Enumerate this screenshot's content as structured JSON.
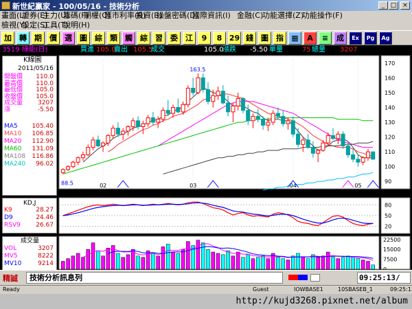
{
  "window": {
    "title": "新世紀贏家 - 100/05/16 - 技術分析"
  },
  "menu1": [
    {
      "label": "畫面(L)"
    },
    {
      "label": "證券(E)"
    },
    {
      "label": "主力(U)"
    },
    {
      "label": "籌碼(F)"
    },
    {
      "label": "期權(O)"
    },
    {
      "label": "匯市利率(R)"
    },
    {
      "label": "投資(B)"
    },
    {
      "label": "操盤密碼(D)"
    },
    {
      "label": "國際資訊(I)"
    },
    {
      "label": "金融(C)"
    },
    {
      "label": "功能選擇(Z)"
    },
    {
      "label": "功能操作(F)"
    }
  ],
  "menu2": [
    {
      "label": "檢視(Y)"
    },
    {
      "label": "設定(S)"
    },
    {
      "label": "工具(T)"
    },
    {
      "label": "說明(H)"
    }
  ],
  "toolbar": [
    {
      "label": "加",
      "icon": "add-icon"
    },
    {
      "label": "轉",
      "icon": "switch-icon"
    },
    {
      "label": "期",
      "icon": "futures-icon"
    },
    {
      "label": "價",
      "icon": "price-icon"
    },
    {
      "label": "選",
      "icon": "select-icon"
    },
    {
      "label": "圖",
      "icon": "chart-icon"
    },
    {
      "label": "綜",
      "icon": "summary-icon"
    },
    {
      "label": "類",
      "icon": "category-icon"
    },
    {
      "label": "觸",
      "icon": "trigger-icon"
    },
    {
      "label": "綜",
      "icon": "summary2-icon"
    },
    {
      "label": "習",
      "icon": "learn-icon"
    },
    {
      "label": "委",
      "icon": "order-icon"
    },
    {
      "label": "江",
      "icon": "river-icon"
    },
    {
      "label": "9",
      "icon": "nine-icon"
    },
    {
      "label": "8",
      "icon": "eight-icon"
    },
    {
      "label": "29",
      "icon": "twentynine-icon"
    },
    {
      "label": "錢",
      "icon": "money-icon"
    },
    {
      "label": "圖",
      "icon": "chart2-icon"
    },
    {
      "label": "指",
      "icon": "index-icon"
    },
    {
      "label": "▦",
      "icon": "grid-icon"
    },
    {
      "label": "A",
      "icon": "a-icon"
    },
    {
      "label": "≡",
      "icon": "list-icon"
    },
    {
      "label": "成",
      "icon": "volume-icon"
    },
    {
      "label": "Ex",
      "icon": "exit-icon"
    },
    {
      "label": "Pg",
      "icon": "page-icon"
    },
    {
      "label": "Ag",
      "icon": "agent-icon"
    }
  ],
  "colors": {
    "up": "#ff0000",
    "down": "#00c0c0",
    "ma5": "#ffffff",
    "ma10": "#ff4040",
    "ma20": "#ff00ff",
    "ma60": "#00ff00",
    "ma120": "#808080",
    "ma240": "#00ffff",
    "k": "#ff0000",
    "d": "#0000ff",
    "vol_up": "#ff00ff",
    "vol_down": "#00ffff"
  },
  "info": {
    "stock": "3519 綠能(日)",
    "bid_label": "買進",
    "bid": "105.0",
    "ask_label": "賣出",
    "ask": "105.5",
    "trade_label": "成交",
    "trade": "105.0",
    "change_label": "漲跌",
    "change": "-5.50",
    "unit_label": "單量",
    "unit": "75",
    "total_label": "總量",
    "total": "3207"
  },
  "kpanel": {
    "title": "K線圖",
    "date": "2011/05/16",
    "rows": [
      {
        "label": "開盤價",
        "value": "110.0"
      },
      {
        "label": "最高價",
        "value": "110.0"
      },
      {
        "label": "最低價",
        "value": "105.0"
      },
      {
        "label": "收盤價",
        "value": "105.0"
      },
      {
        "label": "成交量",
        "value": "3207"
      },
      {
        "label": "漲",
        "value": "-5.50"
      }
    ],
    "ma": [
      {
        "label": "MA5",
        "value": "105.40"
      },
      {
        "label": "MA10",
        "value": "106.85"
      },
      {
        "label": "MA20",
        "value": "112.90"
      },
      {
        "label": "MA60",
        "value": "131.09"
      },
      {
        "label": "MA108",
        "value": "116.86"
      },
      {
        "label": "MA240",
        "value": "96.02"
      }
    ]
  },
  "kdpanel": {
    "title": "KD,J",
    "rows": [
      {
        "label": "K9",
        "value": "28.27"
      },
      {
        "label": "D9",
        "value": "24.46"
      },
      {
        "label": "RSV9",
        "value": "26.67"
      }
    ]
  },
  "volpanel": {
    "title": "成交量",
    "rows": [
      {
        "label": "VOL",
        "value": "3207"
      },
      {
        "label": "MV5",
        "value": "8222"
      },
      {
        "label": "MV10",
        "value": "9214"
      }
    ]
  },
  "chart_data": {
    "type": "candlestick",
    "price_axis": [
      "170",
      "160",
      "150",
      "140",
      "130",
      "120",
      "110",
      "100",
      "90"
    ],
    "x_months": [
      "02",
      "03",
      "04",
      "05"
    ],
    "high_label": "163.5",
    "low_label": "88.5",
    "kd_axis": [
      "80",
      "50",
      "20"
    ],
    "vol_axis": [
      "22500",
      "15000",
      "7500",
      "0"
    ],
    "ylim": [
      85,
      175
    ],
    "candles": [
      [
        96,
        99,
        95,
        98
      ],
      [
        98,
        101,
        97,
        100
      ],
      [
        100,
        104,
        99,
        103
      ],
      [
        103,
        107,
        101,
        106
      ],
      [
        106,
        110,
        104,
        108
      ],
      [
        108,
        115,
        107,
        113
      ],
      [
        113,
        120,
        111,
        118
      ],
      [
        118,
        121,
        113,
        114
      ],
      [
        114,
        117,
        110,
        116
      ],
      [
        116,
        122,
        114,
        121
      ],
      [
        121,
        128,
        119,
        126
      ],
      [
        126,
        130,
        120,
        122
      ],
      [
        122,
        126,
        118,
        124
      ],
      [
        124,
        128,
        121,
        127
      ],
      [
        127,
        133,
        124,
        131
      ],
      [
        131,
        134,
        125,
        127
      ],
      [
        127,
        131,
        122,
        129
      ],
      [
        129,
        135,
        127,
        133
      ],
      [
        133,
        137,
        128,
        130
      ],
      [
        130,
        134,
        126,
        132
      ],
      [
        132,
        140,
        130,
        138
      ],
      [
        138,
        145,
        134,
        136
      ],
      [
        136,
        142,
        133,
        140
      ],
      [
        140,
        146,
        136,
        137
      ],
      [
        137,
        144,
        135,
        142
      ],
      [
        142,
        155,
        140,
        153
      ],
      [
        153,
        160,
        148,
        150
      ],
      [
        150,
        163,
        149,
        160
      ],
      [
        160,
        163,
        150,
        152
      ],
      [
        152,
        157,
        142,
        144
      ],
      [
        144,
        152,
        140,
        148
      ],
      [
        148,
        154,
        145,
        151
      ],
      [
        151,
        155,
        142,
        143
      ],
      [
        143,
        148,
        134,
        137
      ],
      [
        137,
        143,
        130,
        141
      ],
      [
        141,
        150,
        138,
        146
      ],
      [
        146,
        147,
        136,
        138
      ],
      [
        138,
        142,
        128,
        131
      ],
      [
        131,
        136,
        126,
        134
      ],
      [
        134,
        139,
        130,
        132
      ],
      [
        132,
        134,
        125,
        128
      ],
      [
        128,
        133,
        124,
        130
      ],
      [
        130,
        138,
        128,
        136
      ],
      [
        136,
        140,
        132,
        134
      ],
      [
        134,
        138,
        127,
        129
      ],
      [
        129,
        133,
        125,
        131
      ],
      [
        131,
        134,
        120,
        122
      ],
      [
        122,
        126,
        113,
        115
      ],
      [
        115,
        120,
        110,
        118
      ],
      [
        118,
        122,
        112,
        113
      ],
      [
        113,
        117,
        106,
        109
      ],
      [
        109,
        112,
        103,
        111
      ],
      [
        111,
        118,
        110,
        116
      ],
      [
        116,
        123,
        114,
        121
      ],
      [
        121,
        126,
        118,
        119
      ],
      [
        119,
        124,
        115,
        122
      ],
      [
        122,
        124,
        112,
        114
      ],
      [
        114,
        116,
        106,
        108
      ],
      [
        108,
        112,
        103,
        105
      ],
      [
        105,
        108,
        100,
        103
      ],
      [
        103,
        107,
        101,
        106
      ],
      [
        106,
        112,
        104,
        110
      ],
      [
        110,
        110,
        105,
        105
      ]
    ],
    "ma_series": {
      "ma5": [
        null,
        null,
        null,
        null,
        103,
        106,
        109,
        112,
        114,
        116,
        119,
        121,
        122,
        124,
        126,
        127,
        128,
        130,
        131,
        132,
        134,
        135,
        137,
        139,
        140,
        144,
        147,
        150,
        153,
        152,
        150,
        149,
        147,
        144,
        141,
        141,
        141,
        139,
        137,
        136,
        133,
        131,
        132,
        132,
        131,
        131,
        128,
        124,
        120,
        117,
        114,
        111,
        112,
        114,
        117,
        118,
        119,
        117,
        113,
        108,
        106,
        106,
        106
      ],
      "ma10": [
        null,
        null,
        null,
        null,
        null,
        null,
        null,
        null,
        null,
        110,
        112,
        115,
        117,
        119,
        121,
        123,
        125,
        126,
        128,
        129,
        131,
        132,
        134,
        135,
        136,
        138,
        140,
        142,
        145,
        146,
        147,
        148,
        149,
        149,
        148,
        147,
        146,
        144,
        142,
        140,
        138,
        136,
        135,
        134,
        133,
        132,
        131,
        129,
        127,
        124,
        121,
        119,
        117,
        115,
        114,
        113,
        113,
        113,
        112,
        110,
        109,
        108,
        107
      ],
      "ma20": [
        null,
        null,
        null,
        null,
        null,
        null,
        null,
        null,
        null,
        null,
        null,
        null,
        null,
        null,
        null,
        null,
        null,
        null,
        null,
        114,
        116,
        118,
        120,
        122,
        124,
        126,
        128,
        130,
        132,
        134,
        136,
        138,
        140,
        142,
        143,
        144,
        144,
        144,
        144,
        143,
        142,
        141,
        140,
        139,
        138,
        137,
        136,
        134,
        132,
        130,
        128,
        126,
        124,
        122,
        120,
        118,
        117,
        116,
        115,
        114,
        113,
        113,
        113
      ],
      "ma60": [
        95,
        96,
        97,
        98,
        99,
        100,
        101,
        102,
        103,
        104,
        105,
        106,
        107,
        108,
        109,
        110,
        111,
        112,
        113,
        114,
        115,
        116,
        117,
        118,
        119,
        120,
        121,
        122,
        123,
        124,
        125,
        126,
        127,
        128,
        129,
        130,
        130,
        131,
        131,
        132,
        132,
        132,
        133,
        133,
        133,
        133,
        133,
        133,
        133,
        133,
        133,
        133,
        133,
        133,
        133,
        132,
        132,
        132,
        132,
        132,
        131,
        131,
        131
      ],
      "ma120": [
        null,
        null,
        null,
        null,
        null,
        null,
        null,
        null,
        null,
        null,
        null,
        null,
        null,
        null,
        null,
        null,
        null,
        null,
        null,
        null,
        95,
        96,
        97,
        98,
        99,
        100,
        101,
        102,
        103,
        104,
        105,
        106,
        106,
        107,
        107,
        108,
        108,
        109,
        109,
        110,
        110,
        111,
        111,
        111,
        112,
        112,
        112,
        112,
        113,
        113,
        113,
        113,
        114,
        114,
        114,
        114,
        115,
        115,
        115,
        116,
        116,
        116,
        117
      ],
      "ma240": [
        null,
        null,
        null,
        null,
        null,
        null,
        null,
        null,
        null,
        null,
        null,
        null,
        null,
        null,
        null,
        null,
        null,
        null,
        null,
        null,
        null,
        null,
        null,
        null,
        null,
        null,
        null,
        null,
        null,
        null,
        null,
        null,
        null,
        null,
        null,
        null,
        null,
        null,
        null,
        null,
        84,
        85,
        85,
        86,
        86,
        87,
        87,
        88,
        88,
        89,
        89,
        90,
        90,
        91,
        91,
        92,
        92,
        93,
        93,
        94,
        95,
        95,
        96
      ]
    },
    "kd": {
      "k": [
        50,
        55,
        60,
        65,
        70,
        75,
        78,
        80,
        78,
        80,
        82,
        80,
        78,
        80,
        82,
        80,
        78,
        80,
        82,
        80,
        82,
        84,
        82,
        80,
        82,
        86,
        88,
        88,
        84,
        78,
        72,
        70,
        66,
        58,
        52,
        56,
        58,
        52,
        48,
        50,
        48,
        46,
        54,
        58,
        56,
        52,
        44,
        34,
        30,
        28,
        24,
        22,
        30,
        40,
        48,
        50,
        46,
        36,
        28,
        24,
        22,
        26,
        28
      ],
      "d": [
        50,
        52,
        55,
        58,
        62,
        66,
        70,
        73,
        75,
        77,
        78,
        79,
        78,
        79,
        80,
        80,
        79,
        79,
        80,
        80,
        81,
        82,
        82,
        81,
        82,
        83,
        85,
        86,
        85,
        83,
        79,
        76,
        73,
        68,
        63,
        61,
        60,
        57,
        54,
        53,
        51,
        49,
        51,
        53,
        54,
        53,
        50,
        45,
        40,
        36,
        32,
        29,
        29,
        33,
        38,
        42,
        43,
        41,
        37,
        33,
        29,
        28,
        28
      ]
    },
    "volume": [
      6000,
      8000,
      10000,
      12000,
      9000,
      15000,
      20000,
      14000,
      10000,
      16000,
      18000,
      12000,
      9000,
      11000,
      15000,
      10000,
      9000,
      14000,
      12000,
      10000,
      17000,
      19000,
      13000,
      12000,
      15000,
      21000,
      18000,
      22000,
      20000,
      15000,
      13000,
      12000,
      11000,
      14000,
      10000,
      13000,
      9000,
      11000,
      8000,
      9000,
      10000,
      8000,
      12000,
      9000,
      8000,
      7000,
      10000,
      12000,
      9000,
      8000,
      11000,
      9000,
      10000,
      13000,
      9000,
      8000,
      9000,
      10000,
      9000,
      8000,
      7000,
      6000,
      3207
    ]
  },
  "bottom": {
    "tag": "精誠",
    "message": "技術分析訊息列",
    "time": "09:25:13/"
  },
  "status": {
    "ready": "Ready",
    "guest": "Guest",
    "base1": "IOWBASE1",
    "base2": "10SBASEB_1",
    "time": "09:25:13"
  },
  "watermark": "http://kujd3268.pixnet.net/album"
}
